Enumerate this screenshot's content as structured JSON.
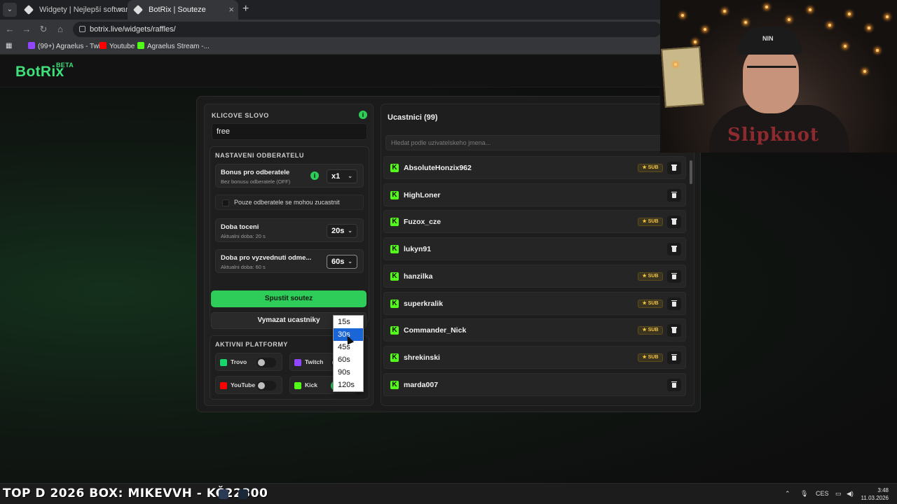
{
  "browser": {
    "tabs": [
      {
        "title": "Widgety | Nejlepší software pro",
        "active": false
      },
      {
        "title": "BotRix | Souteze",
        "active": true
      }
    ],
    "new_tab": "+",
    "url": "botrix.live/widgets/raffles/",
    "bookmarks": [
      "(99+) Agraelus - Twi...",
      "Youtube",
      "Agraelus Stream -..."
    ]
  },
  "app": {
    "logo": "BotRix",
    "logo_badge": "BETA"
  },
  "left": {
    "keyword_label": "KLICOVE SLOVO",
    "keyword_value": "free",
    "subs_section_label": "NASTAVENI ODBERATELU",
    "bonus": {
      "title": "Bonus pro odberatele",
      "subtitle": "Bez bonusu odberatele (OFF)",
      "value": "x1"
    },
    "subs_only": "Pouze odberatele se mohou zucastnit",
    "spin": {
      "title": "Doba toceni",
      "subtitle": "Aktualni doba: 20 s",
      "value": "20s"
    },
    "claim": {
      "title": "Doba pro vyzvednuti odme...",
      "subtitle": "Aktualni doba: 60 s",
      "value": "60s"
    },
    "claim_options": [
      "15s",
      "30s",
      "45s",
      "60s",
      "90s",
      "120s"
    ],
    "claim_highlighted": "30s",
    "start_button": "Spustit soutez",
    "clear_button": "Vymazat ucastniky",
    "platforms_label": "AKTIVNI PLATFORMY",
    "platforms": [
      {
        "name": "Trovo",
        "enabled": false,
        "color": "#19d66b"
      },
      {
        "name": "Twitch",
        "enabled": false,
        "color": "#9146ff"
      },
      {
        "name": "YouTube",
        "enabled": false,
        "color": "#ff0000"
      },
      {
        "name": "Kick",
        "enabled": true,
        "color": "#53fc18"
      }
    ]
  },
  "right": {
    "title": "Ucastnici (99)",
    "search_placeholder": "Hledat podle uzivatelskeho jmena...",
    "sub_badge": "SUB",
    "participants": [
      {
        "name": "AbsoluteHonzix962",
        "sub": true
      },
      {
        "name": "HighLoner",
        "sub": false
      },
      {
        "name": "Fuzox_cze",
        "sub": true
      },
      {
        "name": "lukyn91",
        "sub": false
      },
      {
        "name": "hanzilka",
        "sub": true
      },
      {
        "name": "superkralik",
        "sub": true
      },
      {
        "name": "Commander_Nick",
        "sub": true
      },
      {
        "name": "shrekinski",
        "sub": true
      },
      {
        "name": "marda007",
        "sub": false
      }
    ]
  },
  "webcam": {
    "cap_text": "NIN",
    "shirt_text": "Slipknot"
  },
  "taskbar": {
    "ticker": "TOP D 2026 BOX: MIKEVVH - KČ22300",
    "language": "CES",
    "time": "3:48",
    "date": "11.03.2026"
  },
  "colors": {
    "accent": "#2ecc59",
    "kick": "#53fc18",
    "sub_badge": "#f5c63a",
    "highlight": "#1a66d6"
  }
}
